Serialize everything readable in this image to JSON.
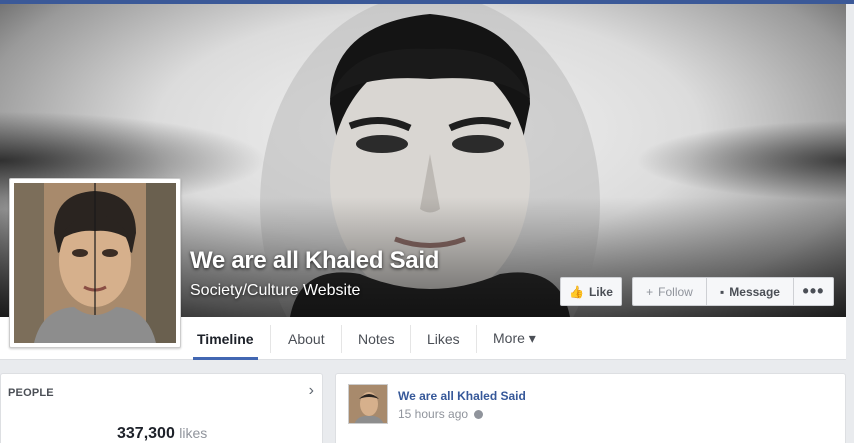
{
  "page": {
    "name": "We are all Khaled Said",
    "category": "Society/Culture Website"
  },
  "actions": {
    "like_label": "Like",
    "follow_label": "Follow",
    "message_label": "Message",
    "more_label": "•••"
  },
  "tabs": [
    {
      "label": "Timeline",
      "active": true
    },
    {
      "label": "About"
    },
    {
      "label": "Notes"
    },
    {
      "label": "Likes"
    },
    {
      "label": "More ▾"
    }
  ],
  "people": {
    "title": "PEOPLE",
    "likes_count": "337,300",
    "likes_label": "likes"
  },
  "post": {
    "author": "We are all Khaled Said",
    "time": "15 hours ago"
  },
  "colors": {
    "brand": "#3b5998",
    "link": "#365899",
    "active_tab": "#4267b2"
  }
}
